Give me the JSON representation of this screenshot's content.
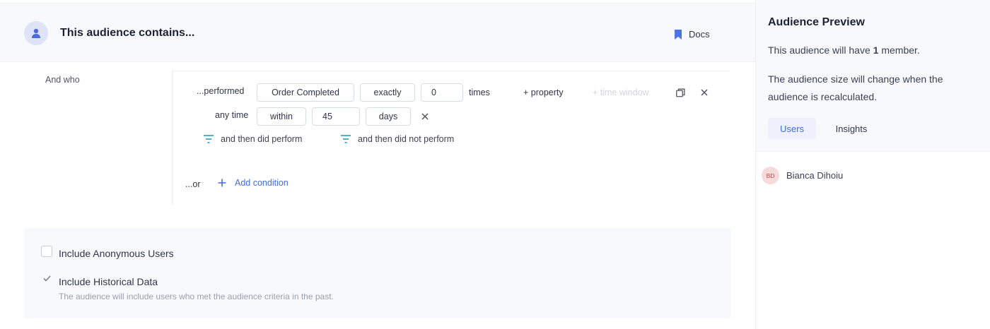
{
  "builder": {
    "header": {
      "title": "This audience contains...",
      "docs_label": "Docs",
      "avatar_icon": "user-icon",
      "docs_icon": "bookmark-icon"
    },
    "and_who_label": "And who",
    "condition": {
      "performed_label": "...performed",
      "event_value": "Order Completed",
      "operator_value": "exactly",
      "count_value": "0",
      "times_label": "times",
      "add_property_label": "+ property",
      "time_window_label": "+ time window",
      "any_time_label": "any time",
      "time_mode_value": "within",
      "time_amount_value": "45",
      "time_unit_value": "days",
      "then_did_perform_label": "and then did perform",
      "then_did_not_perform_label": "and then did not perform"
    },
    "or_label": "...or",
    "add_condition_label": "Add condition",
    "options": {
      "anonymous": {
        "label": "Include Anonymous Users",
        "checked": false
      },
      "historical": {
        "label": "Include Historical Data",
        "checked": true,
        "description": "The audience will include users who met the audience criteria in the past."
      }
    }
  },
  "preview": {
    "title": "Audience Preview",
    "size_prefix": "This audience will have ",
    "size_count": "1",
    "size_suffix": " member.",
    "recalc_line1": "The audience size will change when the",
    "recalc_line2": "audience is recalculated.",
    "tabs": [
      {
        "label": "Users",
        "active": true
      },
      {
        "label": "Insights",
        "active": false
      }
    ],
    "members": [
      {
        "initials": "BD",
        "name": "Bianca Dihoiu"
      }
    ]
  },
  "colors": {
    "accent": "#3f6fd9",
    "filter_icon": "#3aa3c4",
    "bookmark": "#4a74e8"
  }
}
